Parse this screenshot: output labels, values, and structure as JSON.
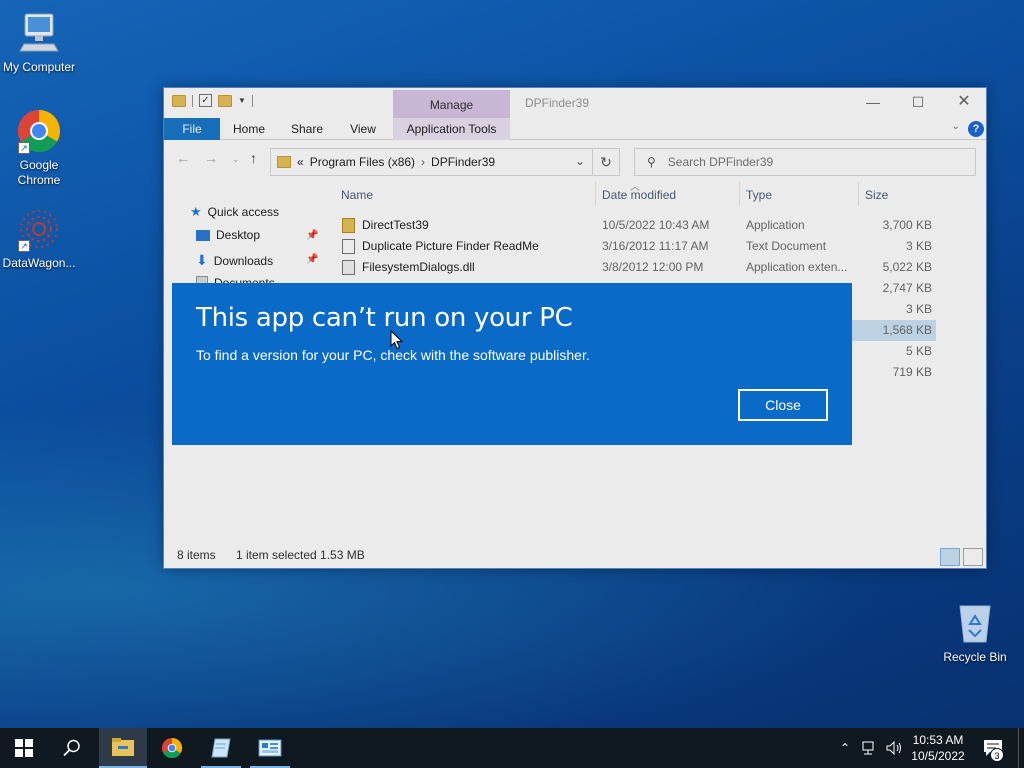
{
  "desktop": {
    "icons": [
      {
        "label": "My Computer"
      },
      {
        "label": "Google Chrome"
      },
      {
        "label": "DataWagon..."
      }
    ],
    "recycle_bin": "Recycle Bin"
  },
  "explorer": {
    "title": "DPFinder39",
    "context_tab": "Manage",
    "ribbon_tabs": [
      "File",
      "Home",
      "Share",
      "View",
      "Application Tools"
    ],
    "address": {
      "prefix": "«",
      "crumbs": [
        "Program Files (x86)",
        "DPFinder39"
      ]
    },
    "search_placeholder": "Search DPFinder39",
    "nav": {
      "quick_access": "Quick access",
      "items": [
        "Desktop",
        "Downloads",
        "Documents"
      ]
    },
    "columns": [
      "Name",
      "Date modified",
      "Type",
      "Size"
    ],
    "files": [
      {
        "name": "DirectTest39",
        "date": "10/5/2022 10:43 AM",
        "type": "Application",
        "size": "3,700 KB"
      },
      {
        "name": "Duplicate Picture Finder ReadMe",
        "date": "3/16/2012 11:17 AM",
        "type": "Text Document",
        "size": "3 KB"
      },
      {
        "name": "FilesystemDialogs.dll",
        "date": "3/8/2012 12:00 PM",
        "type": "Application exten...",
        "size": "5,022 KB"
      }
    ],
    "hidden_sizes": [
      "2,747 KB",
      "3 KB",
      "1,568 KB",
      "5 KB",
      "719 KB"
    ],
    "status": {
      "items": "8 items",
      "selection": "1 item selected  1.53 MB"
    }
  },
  "dialog": {
    "title": "This app can’t run on your PC",
    "message": "To find a version for your PC, check with the software publisher.",
    "close_label": "Close"
  },
  "taskbar": {
    "time": "10:53 AM",
    "date": "10/5/2022",
    "notification_count": "3"
  },
  "colors": {
    "dialog_bg": "#0a6ac7",
    "file_tab": "#1979ca",
    "manage_tab": "#d9c6e8",
    "taskbar": "#101820"
  }
}
